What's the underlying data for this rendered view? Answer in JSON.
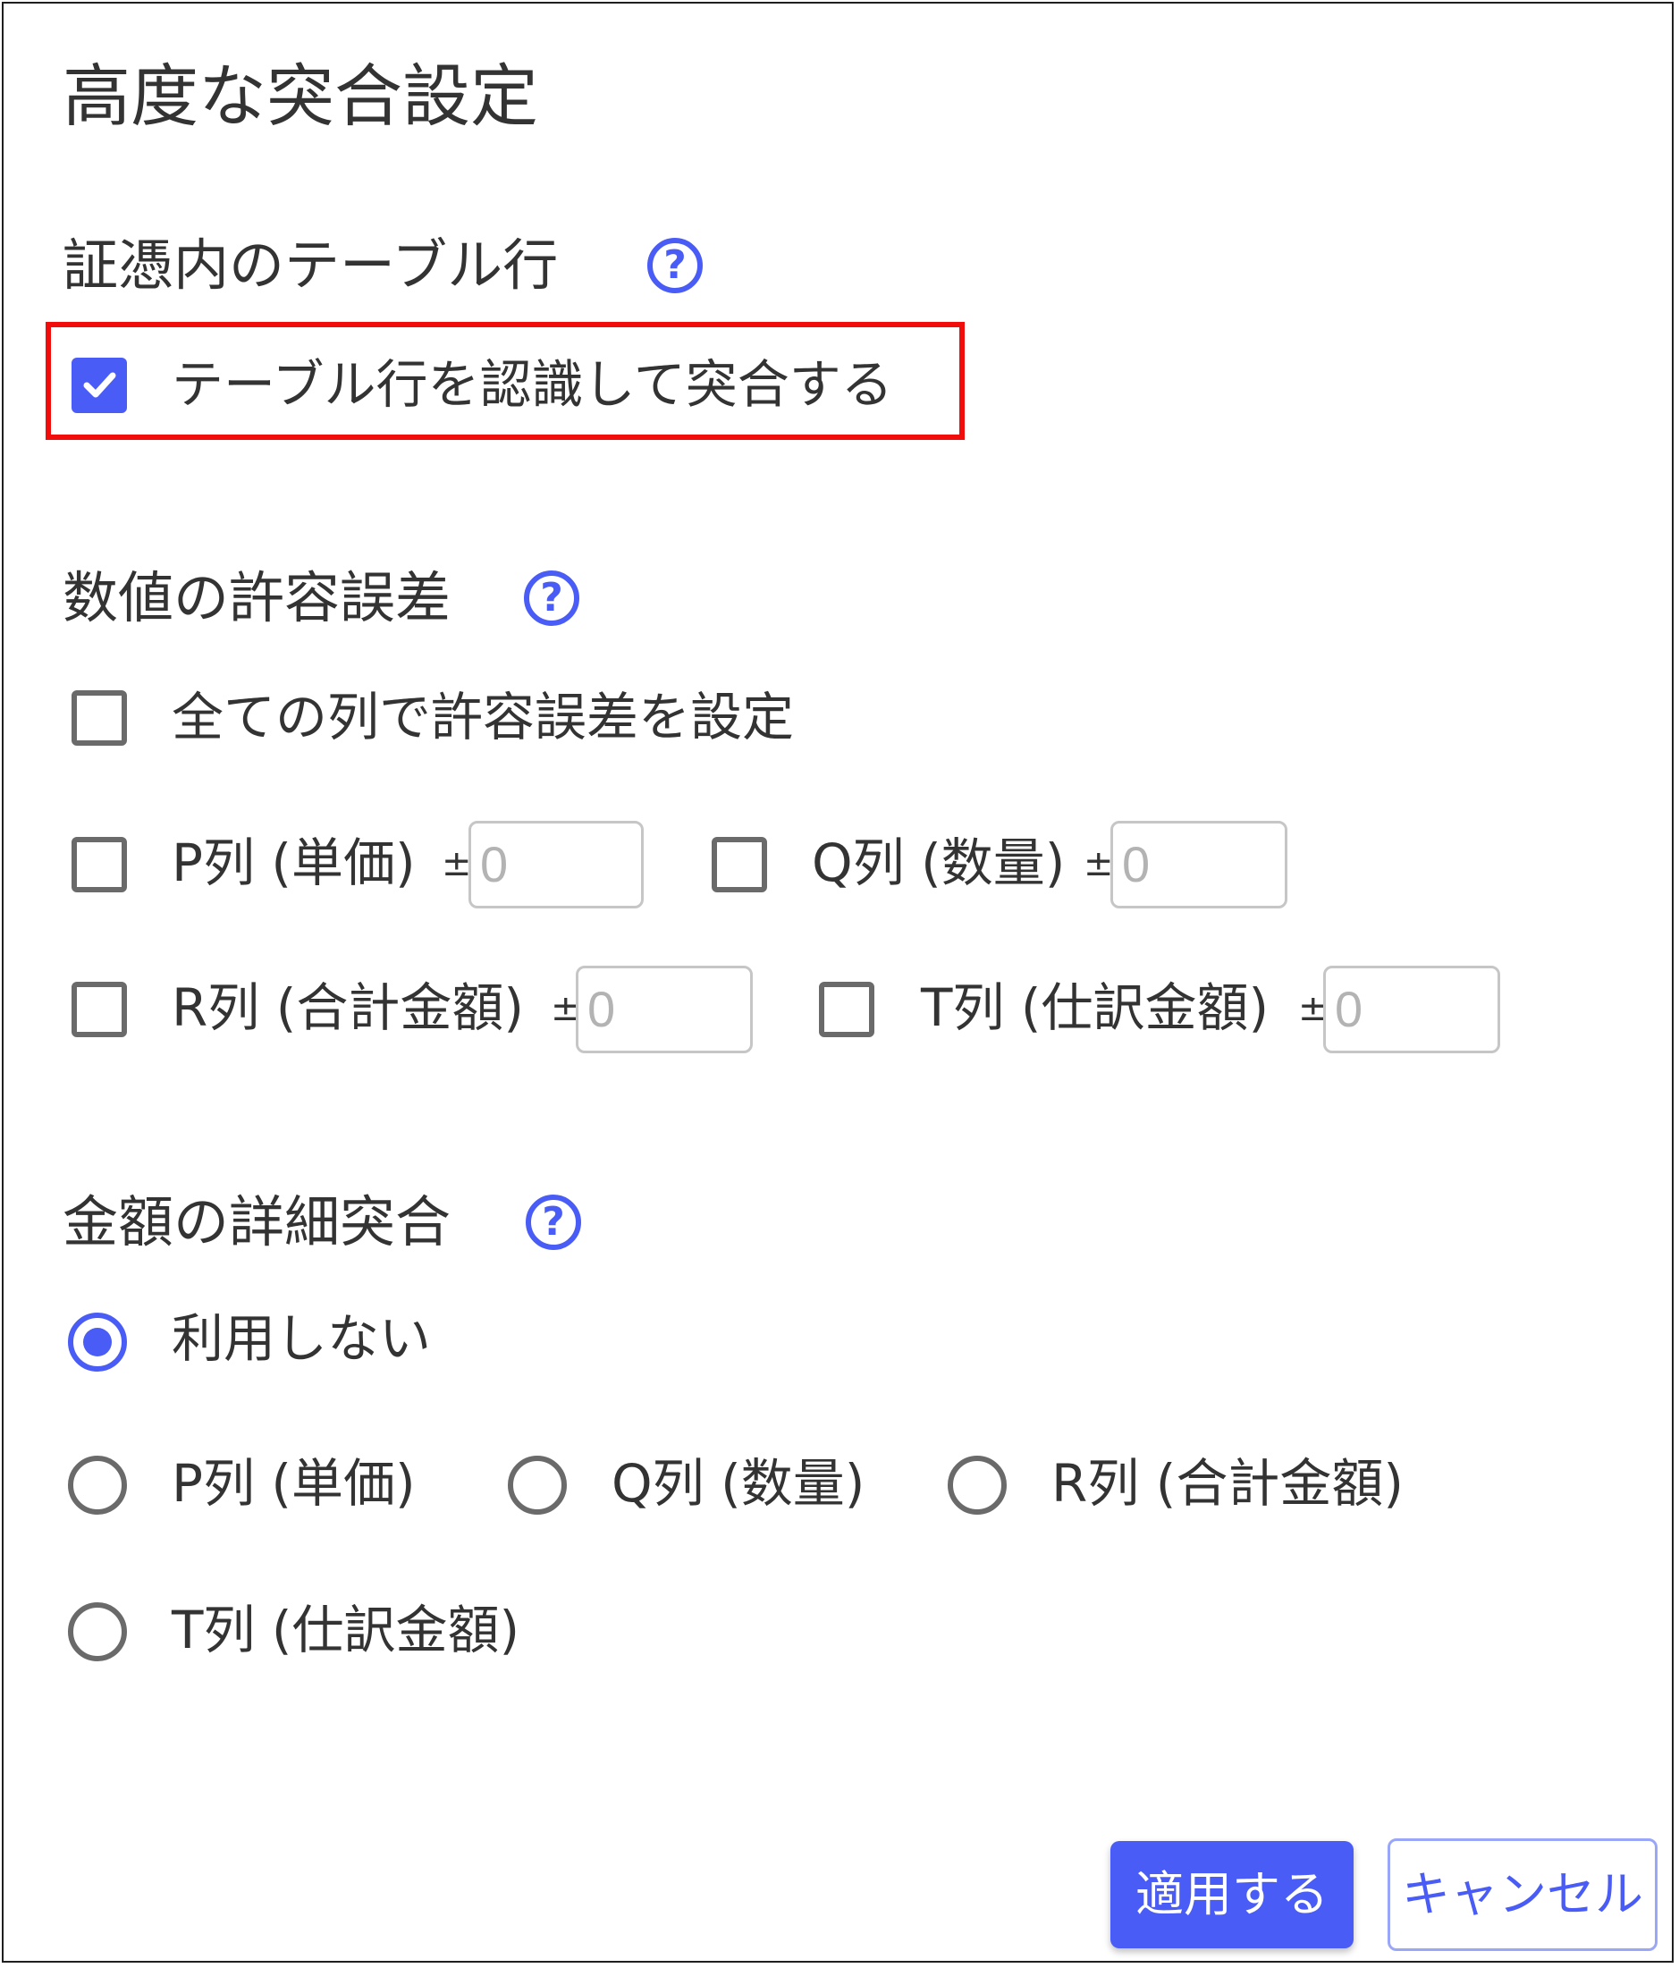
{
  "dialog": {
    "title": "高度な突合設定",
    "sections": {
      "table_rows": {
        "title": "証憑内のテーブル行",
        "help_icon": "question-circle-icon",
        "checkbox": {
          "label": "テーブル行を認識して突合する",
          "checked": true
        }
      },
      "tolerance": {
        "title": "数値の許容誤差",
        "help_icon": "question-circle-icon",
        "all_columns": {
          "label": "全ての列で許容誤差を設定",
          "checked": false
        },
        "columns": [
          {
            "label": "P列 (単価)",
            "pm": "±",
            "value": "0",
            "checked": false
          },
          {
            "label": "Q列 (数量)",
            "pm": "±",
            "value": "0",
            "checked": false
          },
          {
            "label": "R列 (合計金額)",
            "pm": "±",
            "value": "0",
            "checked": false
          },
          {
            "label": "T列 (仕訳金額)",
            "pm": "±",
            "value": "0",
            "checked": false
          }
        ]
      },
      "amount_detail": {
        "title": "金額の詳細突合",
        "help_icon": "question-circle-icon",
        "options": [
          {
            "label": "利用しない",
            "selected": true
          },
          {
            "label": "P列 (単価)",
            "selected": false
          },
          {
            "label": "Q列 (数量)",
            "selected": false
          },
          {
            "label": "R列 (合計金額)",
            "selected": false
          },
          {
            "label": "T列 (仕訳金額)",
            "selected": false
          }
        ]
      }
    },
    "buttons": {
      "apply": "適用する",
      "cancel": "キャンセル"
    }
  },
  "colors": {
    "accent": "#4a5cf6",
    "highlight_border": "#f20d0d",
    "text": "#333333",
    "border": "#6a6a6a"
  }
}
